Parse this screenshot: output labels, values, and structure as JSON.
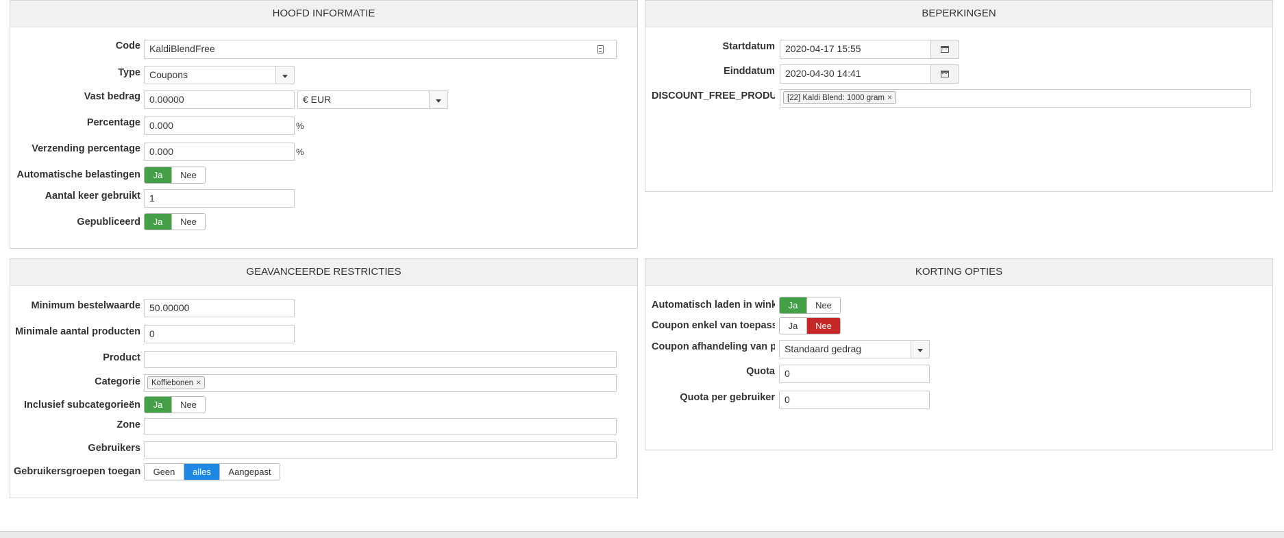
{
  "hoofd": {
    "title": "HOOFD INFORMATIE",
    "code_label": "Code",
    "code_value": "KaldiBlendFree",
    "type_label": "Type",
    "type_value": "Coupons",
    "vast_label": "Vast bedrag",
    "vast_value": "0.00000",
    "currency_value": "€ EUR",
    "percentage_label": "Percentage",
    "percentage_value": "0.000",
    "percentage_suffix": "%",
    "verzending_label": "Verzending percentage",
    "verzending_value": "0.000",
    "verzending_suffix": "%",
    "auto_tax_label": "Automatische belastingen",
    "aantal_label": "Aantal keer gebruikt",
    "aantal_value": "1",
    "published_label": "Gepubliceerd"
  },
  "toggles": {
    "ja": "Ja",
    "nee": "Nee"
  },
  "beperkingen": {
    "title": "BEPERKINGEN",
    "start_label": "Startdatum",
    "start_value": "2020-04-17 15:55",
    "end_label": "Einddatum",
    "end_value": "2020-04-30 14:41",
    "free_label": "DISCOUNT_FREE_PRODU...",
    "free_tag": "[22] Kaldi Blend: 1000 gram",
    "tag_remove": "×"
  },
  "geavanceerd": {
    "title": "GEAVANCEERDE RESTRICTIES",
    "min_label": "Minimum bestelwaarde",
    "min_value": "50.00000",
    "min_products_label": "Minimale aantal producten",
    "min_products_value": "0",
    "product_label": "Product",
    "categorie_label": "Categorie",
    "categorie_tag": "Koffiebonen",
    "tag_remove": "×",
    "subcat_label": "Inclusief subcategorieën",
    "zone_label": "Zone",
    "users_label": "Gebruikers",
    "groups_label": "Gebruikersgroepen toegang",
    "groups_options": [
      "Geen",
      "alles",
      "Aangepast"
    ],
    "groups_selected": "alles"
  },
  "korting": {
    "title": "KORTING OPTIES",
    "auto_load_label": "Automatisch laden in wink...",
    "coupon_only_label": "Coupon enkel van toepass...",
    "handling_label": "Coupon afhandeling van p...",
    "handling_value": "Standaard gedrag",
    "quota_label": "Quota",
    "quota_value": "0",
    "quota_user_label": "Quota per gebruiker",
    "quota_user_value": "0"
  },
  "colors": {
    "green": "#43a047",
    "red": "#c62828",
    "blue": "#1e88e5"
  }
}
